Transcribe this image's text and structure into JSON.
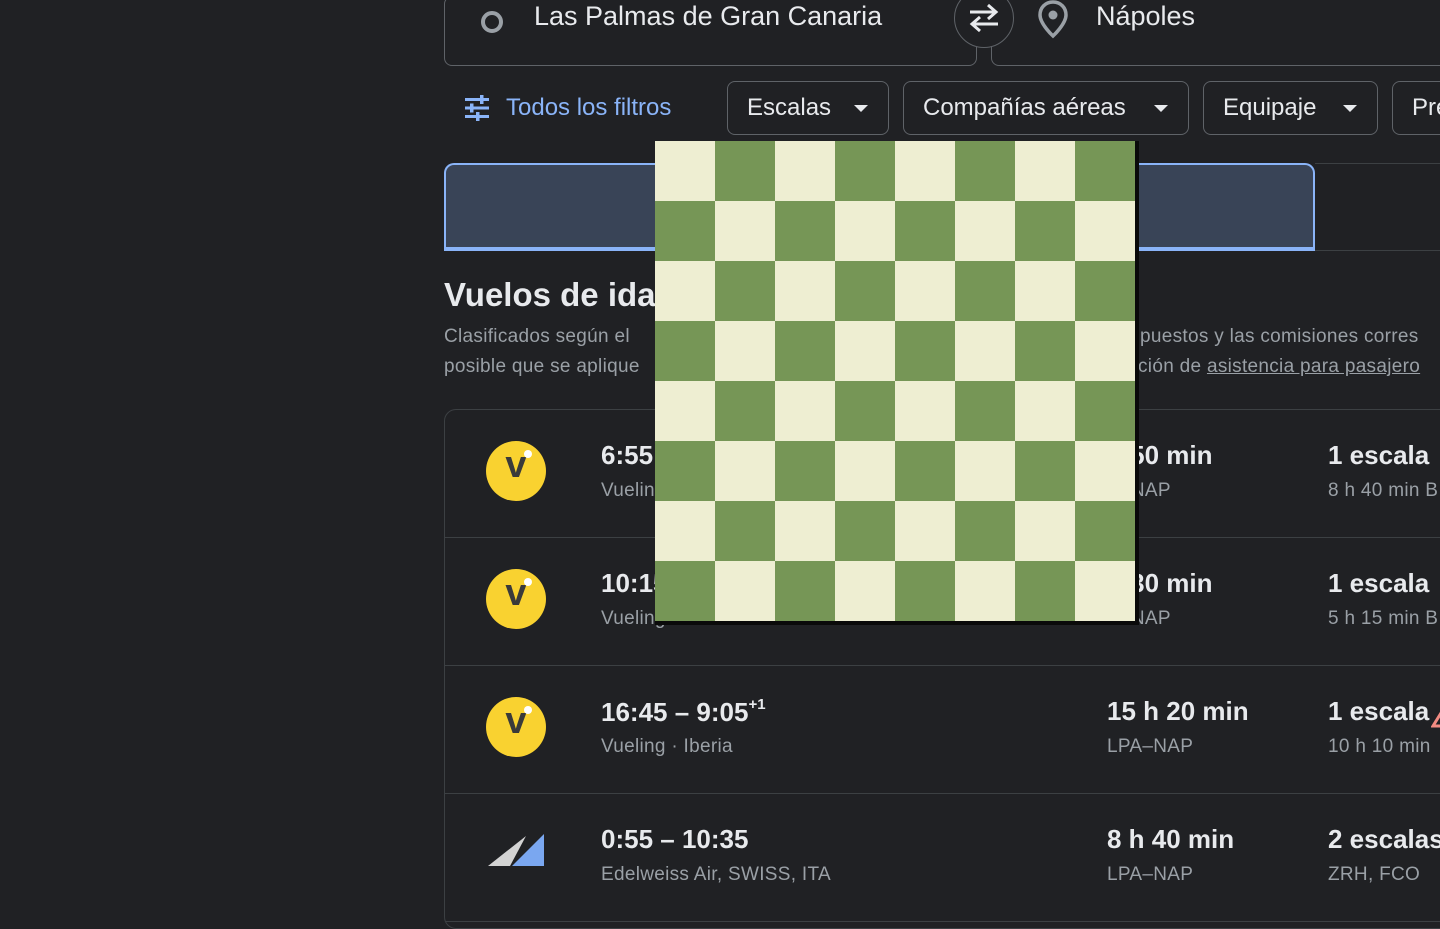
{
  "search": {
    "origin": "Las Palmas de Gran Canaria",
    "destination": "Nápoles"
  },
  "filters": {
    "all_filters": "Todos los filtros",
    "chips": [
      "Escalas",
      "Compañías aéreas",
      "Equipaje",
      "Pre"
    ]
  },
  "section": {
    "title": "Vuelos de ida",
    "desc_line1_start": "Clasificados según el",
    "desc_line1_end": "puestos y las comisiones corres",
    "desc_line2_start": "posible que se aplique",
    "desc_line2_mid": "ción de ",
    "desc_line2_link": "asistencia para pasajero"
  },
  "flights": [
    {
      "times": "6:55",
      "plus_day": "",
      "carrier": "Vuelin",
      "duration": "h 50 min",
      "route": "A–NAP",
      "stops": "1 escala",
      "stops_detail": "8 h 40 min B",
      "logo": "vueling-logo"
    },
    {
      "times": "10:15",
      "plus_day": "",
      "carrier": "Vueling",
      "duration": "h 30 min",
      "route": "A–NAP",
      "stops": "1 escala",
      "stops_detail": "5 h 15 min B",
      "logo": "vueling-logo"
    },
    {
      "times": "16:45 – 9:05",
      "plus_day": "+1",
      "carrier": "Vueling · Iberia",
      "duration": "15 h 20 min",
      "route": "LPA–NAP",
      "stops": "1 escala",
      "stops_detail": "10 h 10 min",
      "logo": "vueling-logo",
      "warning": "warning-icon"
    },
    {
      "times": "0:55 – 10:35",
      "plus_day": "",
      "carrier": "Edelweiss Air, SWISS, ITA",
      "duration": "8 h 40 min",
      "route": "LPA–NAP",
      "stops": "2 escalas",
      "stops_detail": "ZRH, FCO",
      "logo": "edelweiss-logo"
    }
  ],
  "colors": {
    "background": "#202124",
    "accent": "#8ab4f8",
    "tab_selected_bg": "#394457",
    "vueling_yellow": "#f9d230",
    "board_light": "#eeeed2",
    "board_dark": "#769656"
  },
  "icons": {
    "origin": "circle-icon",
    "swap": "swap-arrows-icon",
    "destination": "location-pin-icon",
    "filters": "tune-icon",
    "dropdown": "caret-down-icon"
  }
}
